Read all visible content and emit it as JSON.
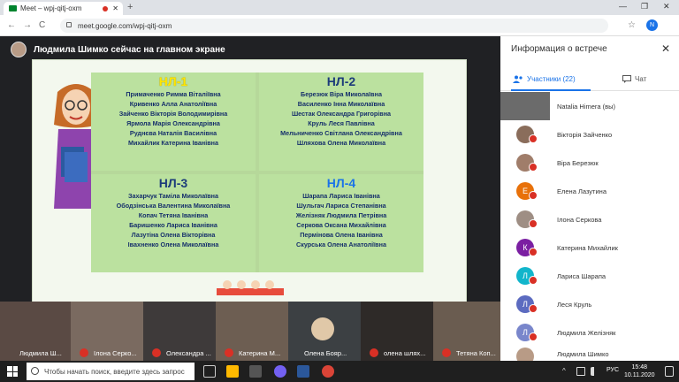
{
  "browser": {
    "tab_title": "Meet – wpj-qitj-oxm",
    "tab_close": "✕",
    "new_tab": "+",
    "url": "meet.google.com/wpj-qitj-oxm",
    "profile_initial": "N",
    "win_min": "—",
    "win_max": "❐",
    "win_close": "✕",
    "back": "←",
    "forward": "→",
    "reload": "C",
    "star": "☆"
  },
  "meet": {
    "presenter_text": "Людмила Шимко сейчас на главном экране",
    "slide": {
      "groups": [
        {
          "title": "НЛ-1",
          "color": "#ffe600",
          "members": [
            "Примаченко Римма Віталіївна",
            "Кривенко Алла Анатоліївна",
            "Зайченко Вікторія Володимирівна",
            "Ярмола Марія Олександрівна",
            "Руднєва Наталія Василівна",
            "Михайлик Катерина Іванівна"
          ]
        },
        {
          "title": "НЛ-2",
          "color": "#1c3b7a",
          "members": [
            "Березюк Віра Миколаївна",
            "Василенко Інна Миколаївна",
            "Шестак Олександра Григорівна",
            "Круль Леся Павлівна",
            "Мельниченко Світлана Олександрівна",
            "Шляхова Олена Миколаївна"
          ]
        },
        {
          "title": "НЛ-3",
          "color": "#1c3b7a",
          "members": [
            "Захарчук Таміла Миколаївна",
            "Ободзінська Валентина Миколаївна",
            "Копач Тетяна Іванівна",
            "Баришенко Лариса Іванівна",
            "Лазутіна Олена Вікторівна",
            "Івахненко Олена Миколаївна"
          ]
        },
        {
          "title": "НЛ-4",
          "color": "#1a73e8",
          "members": [
            "Шарапа Лариса Іванівна",
            "Шульгач Лариса Степанівна",
            "Желізняк Людмила Петрівна",
            "Серкова Оксана Михайлівна",
            "Пермінова Олена Іванівна",
            "Скурська Олена Анатоліївна"
          ]
        }
      ]
    }
  },
  "panel": {
    "title": "Информация о встрече",
    "close": "✕",
    "tab_participants": "Участники (22)",
    "tab_chat": "Чат",
    "participants": [
      {
        "name": "Natalia Himera (вы)",
        "initial": "",
        "color": "#6b6b6b",
        "self": true
      },
      {
        "name": "Вікторія Зайченко",
        "initial": "",
        "color": "#8a6d5b"
      },
      {
        "name": "Віра Березюк",
        "initial": "",
        "color": "#a07d6a"
      },
      {
        "name": "Елена Лазутина",
        "initial": "Е",
        "color": "#e8710a"
      },
      {
        "name": "Ілона Серкова",
        "initial": "",
        "color": "#9e8e84"
      },
      {
        "name": "Катерина Михайлик",
        "initial": "К",
        "color": "#7b1fa2"
      },
      {
        "name": "Лариса Шарапа",
        "initial": "Л",
        "color": "#12b5cb"
      },
      {
        "name": "Леся Круль",
        "initial": "Л",
        "color": "#5c6bc0"
      },
      {
        "name": "Людмила Желізняк",
        "initial": "Л",
        "color": "#7986cb"
      },
      {
        "name": "Людмила Шимко",
        "initial": "",
        "color": "#b89b86"
      }
    ]
  },
  "strip": {
    "tiles": [
      {
        "label": "Людмила Ш...",
        "bg": "#5a4a44",
        "muted": false
      },
      {
        "label": "Ілона Серко...",
        "bg": "#7a6a60",
        "muted": true
      },
      {
        "label": "Олександра ...",
        "bg": "#3e3a3a",
        "muted": true
      },
      {
        "label": "Катерина М...",
        "bg": "#6d5e52",
        "muted": true
      },
      {
        "label": "Олена Бояр...",
        "bg": "#3c4043",
        "muted": false
      },
      {
        "label": "олена шлях...",
        "bg": "#2e2a28",
        "muted": true
      },
      {
        "label": "Тетяна Коп...",
        "bg": "#6a5c50",
        "muted": true
      }
    ]
  },
  "taskbar": {
    "search_placeholder": "Чтобы начать поиск, введите здесь запрос",
    "lang": "РУС",
    "time": "15:48",
    "date": "10.11.2020",
    "tray_caret": "^"
  }
}
